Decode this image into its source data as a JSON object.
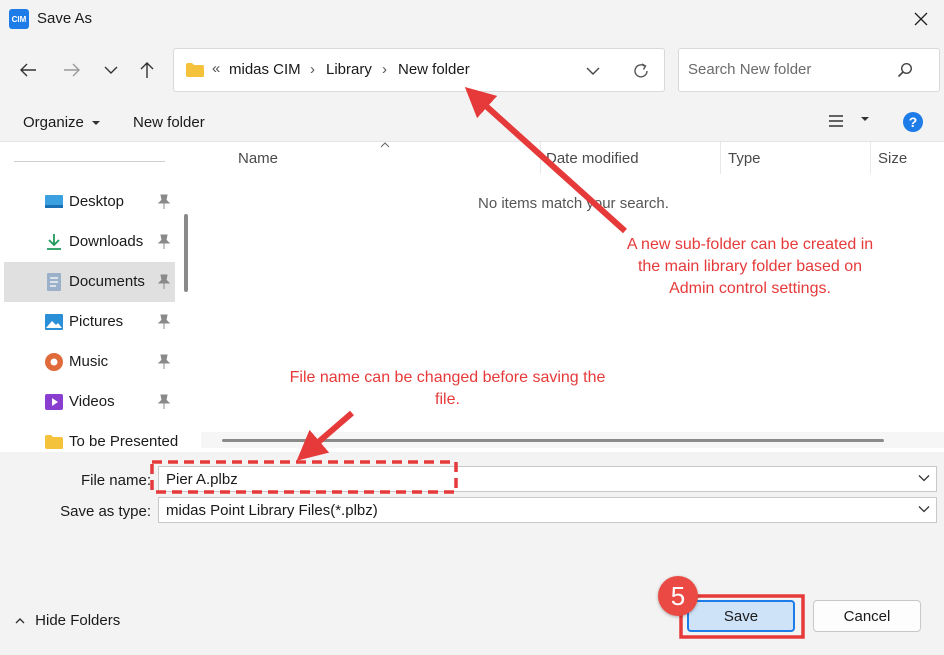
{
  "window": {
    "title": "Save As",
    "logo_text": "CIM"
  },
  "address": {
    "overflow": "«",
    "crumbs": [
      "midas CIM",
      "Library",
      "New folder"
    ]
  },
  "search": {
    "placeholder": "Search New folder"
  },
  "commandbar": {
    "organize_label": "Organize",
    "new_folder_label": "New folder"
  },
  "sidebar": {
    "items": [
      {
        "label": "Desktop",
        "icon": "desktop-icon"
      },
      {
        "label": "Downloads",
        "icon": "downloads-icon"
      },
      {
        "label": "Documents",
        "icon": "documents-icon"
      },
      {
        "label": "Pictures",
        "icon": "pictures-icon"
      },
      {
        "label": "Music",
        "icon": "music-icon"
      },
      {
        "label": "Videos",
        "icon": "videos-icon"
      },
      {
        "label": "To be Presented",
        "icon": "folder-icon"
      }
    ]
  },
  "filelist": {
    "columns": [
      "Name",
      "Date modified",
      "Type",
      "Size"
    ],
    "empty_message": "No items match your search."
  },
  "form": {
    "filename_label": "File name:",
    "filename_value": "Pier A.plbz",
    "savetype_label": "Save as type:",
    "savetype_value": "midas Point Library Files(*.plbz)"
  },
  "footer": {
    "hide_folders_label": "Hide Folders",
    "save_label": "Save",
    "cancel_label": "Cancel"
  },
  "annotations": {
    "subfolder_note_lines": [
      "A new sub-folder can be created in",
      "the main library folder based on",
      "Admin control settings."
    ],
    "filename_note_lines": [
      "File name can be changed before saving the",
      "file."
    ],
    "step_number": "5"
  },
  "colors": {
    "accent": "#1e7ce8",
    "annotation_red": "#e63a3a",
    "save_button_bg": "#cfe3f8"
  }
}
